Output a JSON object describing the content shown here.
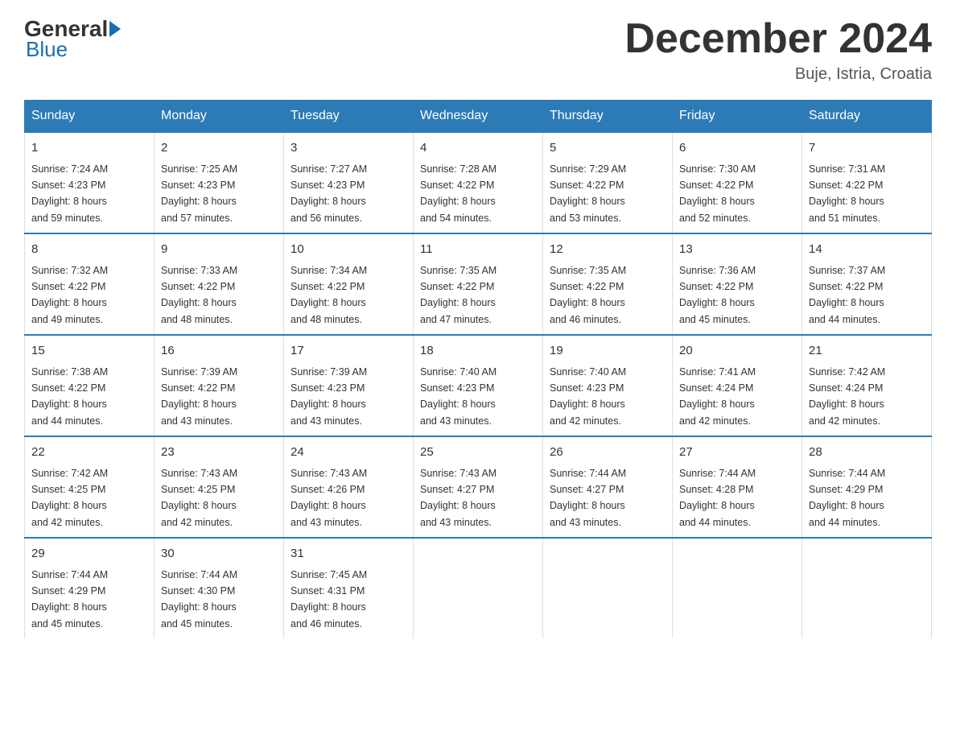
{
  "header": {
    "logo": {
      "line1": "General",
      "line2": "Blue"
    },
    "title": "December 2024",
    "location": "Buje, Istria, Croatia"
  },
  "days_of_week": [
    "Sunday",
    "Monday",
    "Tuesday",
    "Wednesday",
    "Thursday",
    "Friday",
    "Saturday"
  ],
  "weeks": [
    [
      {
        "day": "1",
        "sunrise": "7:24 AM",
        "sunset": "4:23 PM",
        "daylight": "8 hours and 59 minutes."
      },
      {
        "day": "2",
        "sunrise": "7:25 AM",
        "sunset": "4:23 PM",
        "daylight": "8 hours and 57 minutes."
      },
      {
        "day": "3",
        "sunrise": "7:27 AM",
        "sunset": "4:23 PM",
        "daylight": "8 hours and 56 minutes."
      },
      {
        "day": "4",
        "sunrise": "7:28 AM",
        "sunset": "4:22 PM",
        "daylight": "8 hours and 54 minutes."
      },
      {
        "day": "5",
        "sunrise": "7:29 AM",
        "sunset": "4:22 PM",
        "daylight": "8 hours and 53 minutes."
      },
      {
        "day": "6",
        "sunrise": "7:30 AM",
        "sunset": "4:22 PM",
        "daylight": "8 hours and 52 minutes."
      },
      {
        "day": "7",
        "sunrise": "7:31 AM",
        "sunset": "4:22 PM",
        "daylight": "8 hours and 51 minutes."
      }
    ],
    [
      {
        "day": "8",
        "sunrise": "7:32 AM",
        "sunset": "4:22 PM",
        "daylight": "8 hours and 49 minutes."
      },
      {
        "day": "9",
        "sunrise": "7:33 AM",
        "sunset": "4:22 PM",
        "daylight": "8 hours and 48 minutes."
      },
      {
        "day": "10",
        "sunrise": "7:34 AM",
        "sunset": "4:22 PM",
        "daylight": "8 hours and 48 minutes."
      },
      {
        "day": "11",
        "sunrise": "7:35 AM",
        "sunset": "4:22 PM",
        "daylight": "8 hours and 47 minutes."
      },
      {
        "day": "12",
        "sunrise": "7:35 AM",
        "sunset": "4:22 PM",
        "daylight": "8 hours and 46 minutes."
      },
      {
        "day": "13",
        "sunrise": "7:36 AM",
        "sunset": "4:22 PM",
        "daylight": "8 hours and 45 minutes."
      },
      {
        "day": "14",
        "sunrise": "7:37 AM",
        "sunset": "4:22 PM",
        "daylight": "8 hours and 44 minutes."
      }
    ],
    [
      {
        "day": "15",
        "sunrise": "7:38 AM",
        "sunset": "4:22 PM",
        "daylight": "8 hours and 44 minutes."
      },
      {
        "day": "16",
        "sunrise": "7:39 AM",
        "sunset": "4:22 PM",
        "daylight": "8 hours and 43 minutes."
      },
      {
        "day": "17",
        "sunrise": "7:39 AM",
        "sunset": "4:23 PM",
        "daylight": "8 hours and 43 minutes."
      },
      {
        "day": "18",
        "sunrise": "7:40 AM",
        "sunset": "4:23 PM",
        "daylight": "8 hours and 43 minutes."
      },
      {
        "day": "19",
        "sunrise": "7:40 AM",
        "sunset": "4:23 PM",
        "daylight": "8 hours and 42 minutes."
      },
      {
        "day": "20",
        "sunrise": "7:41 AM",
        "sunset": "4:24 PM",
        "daylight": "8 hours and 42 minutes."
      },
      {
        "day": "21",
        "sunrise": "7:42 AM",
        "sunset": "4:24 PM",
        "daylight": "8 hours and 42 minutes."
      }
    ],
    [
      {
        "day": "22",
        "sunrise": "7:42 AM",
        "sunset": "4:25 PM",
        "daylight": "8 hours and 42 minutes."
      },
      {
        "day": "23",
        "sunrise": "7:43 AM",
        "sunset": "4:25 PM",
        "daylight": "8 hours and 42 minutes."
      },
      {
        "day": "24",
        "sunrise": "7:43 AM",
        "sunset": "4:26 PM",
        "daylight": "8 hours and 43 minutes."
      },
      {
        "day": "25",
        "sunrise": "7:43 AM",
        "sunset": "4:27 PM",
        "daylight": "8 hours and 43 minutes."
      },
      {
        "day": "26",
        "sunrise": "7:44 AM",
        "sunset": "4:27 PM",
        "daylight": "8 hours and 43 minutes."
      },
      {
        "day": "27",
        "sunrise": "7:44 AM",
        "sunset": "4:28 PM",
        "daylight": "8 hours and 44 minutes."
      },
      {
        "day": "28",
        "sunrise": "7:44 AM",
        "sunset": "4:29 PM",
        "daylight": "8 hours and 44 minutes."
      }
    ],
    [
      {
        "day": "29",
        "sunrise": "7:44 AM",
        "sunset": "4:29 PM",
        "daylight": "8 hours and 45 minutes."
      },
      {
        "day": "30",
        "sunrise": "7:44 AM",
        "sunset": "4:30 PM",
        "daylight": "8 hours and 45 minutes."
      },
      {
        "day": "31",
        "sunrise": "7:45 AM",
        "sunset": "4:31 PM",
        "daylight": "8 hours and 46 minutes."
      },
      null,
      null,
      null,
      null
    ]
  ],
  "labels": {
    "sunrise": "Sunrise:",
    "sunset": "Sunset:",
    "daylight": "Daylight:"
  },
  "colors": {
    "header_bg": "#2c7bb6",
    "header_text": "#ffffff",
    "border_top": "#2c7bb6"
  }
}
